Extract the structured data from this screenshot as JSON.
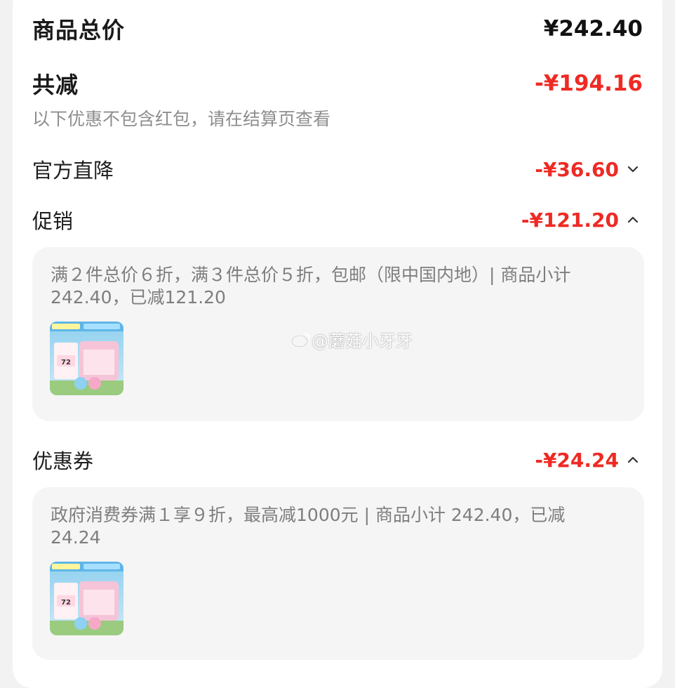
{
  "summary": {
    "total_label": "商品总价",
    "total_value": "¥242.40",
    "reduce_label": "共减",
    "reduce_value": "-¥194.16",
    "note": "以下优惠不包含红包，请在结算页查看"
  },
  "discounts": [
    {
      "label": "官方直降",
      "value": "-¥36.60",
      "chevron": "chevron-down-icon"
    },
    {
      "label": "促销",
      "value": "-¥121.20",
      "chevron": "chevron-up-icon",
      "detail": "满２件总价６折，满３件总价５折，包邮（限中国内地）| 商品小计 242.40，已减121.20"
    },
    {
      "label": "优惠券",
      "value": "-¥24.24",
      "chevron": "chevron-up-icon",
      "detail": "政府消费券满１享９折，最高减1000元 | 商品小计 242.40，已减 24.24"
    }
  ],
  "thumbnail": {
    "badge_text": "72"
  },
  "watermark": "@蘑菇小牙牙",
  "colors": {
    "accent_red": "#ee2a24",
    "panel_bg": "#f5f5f5",
    "muted_text": "#8e8e8e"
  }
}
